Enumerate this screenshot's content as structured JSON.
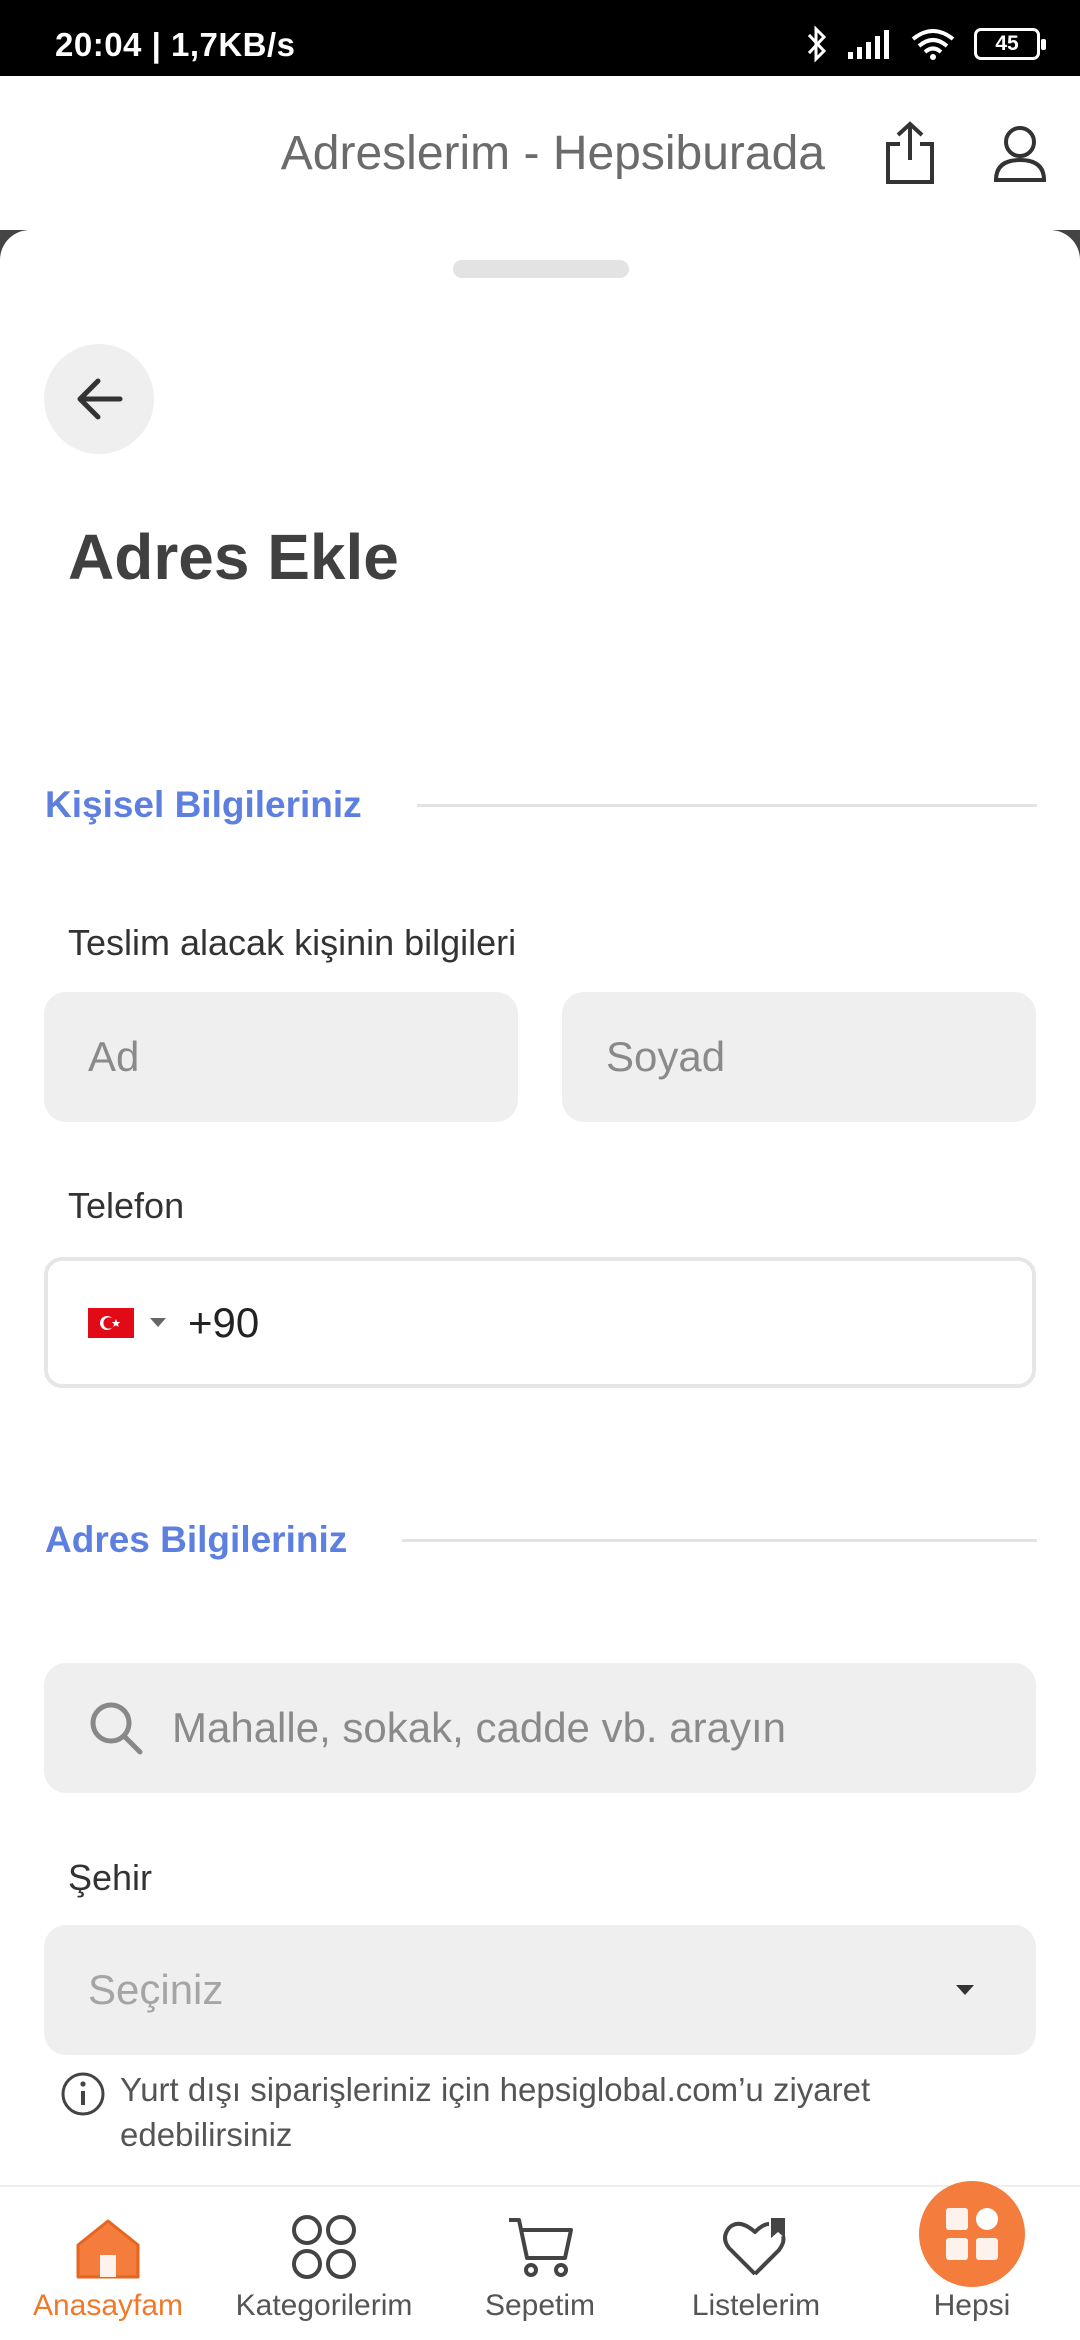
{
  "status_bar": {
    "time": "20:04 | 1,7KB/s",
    "battery": "45"
  },
  "header": {
    "title": "Adreslerim - Hepsiburada"
  },
  "page": {
    "title": "Adres Ekle"
  },
  "personal_section": {
    "heading": "Kişisel Bilgileriniz",
    "recipient_label": "Teslim alacak kişinin bilgileri",
    "first_name_placeholder": "Ad",
    "last_name_placeholder": "Soyad",
    "phone_label": "Telefon",
    "phone_code": "+90"
  },
  "address_section": {
    "heading": "Adres Bilgileriniz",
    "search_placeholder": "Mahalle, sokak, cadde vb. arayın",
    "city_label": "Şehir",
    "city_placeholder": "Seçiniz",
    "info_text": "Yurt dışı siparişleriniz için hepsiglobal.com’u ziyaret edebilirsiniz"
  },
  "bottom_nav": {
    "items": [
      {
        "label": "Anasayfam",
        "icon": "home-icon",
        "active": true
      },
      {
        "label": "Kategorilerim",
        "icon": "categories-icon",
        "active": false
      },
      {
        "label": "Sepetim",
        "icon": "cart-icon",
        "active": false
      },
      {
        "label": "Listelerim",
        "icon": "heart-list-icon",
        "active": false
      },
      {
        "label": "Hepsi",
        "icon": "hepsi-icon",
        "active": false
      }
    ]
  },
  "colors": {
    "accent_blue": "#5c7fe0",
    "brand_orange": "#f47c3c",
    "active_nav": "#f07a2a",
    "input_bg": "#efefef"
  }
}
